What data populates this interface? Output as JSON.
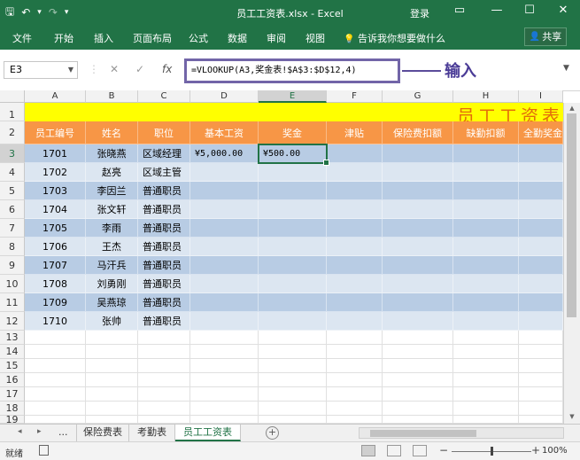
{
  "window": {
    "title": "员工工资表.xlsx - Excel",
    "login": "登录",
    "restore_icon": "▭",
    "minimize_icon": "—",
    "maximize_icon": "☐",
    "close_icon": "✕"
  },
  "qat": {
    "save_icon": "🖫",
    "undo_icon": "↶",
    "undo_dd": "▾",
    "redo_icon": "↷",
    "customize": "▾"
  },
  "ribbon": {
    "tabs": [
      "文件",
      "开始",
      "插入",
      "页面布局",
      "公式",
      "数据",
      "审阅",
      "视图"
    ],
    "tell_me": "告诉我你想要做什么",
    "tell_icon": "💡",
    "share": "共享",
    "share_icon": "👤"
  },
  "formula_bar": {
    "name_box": "E3",
    "cancel_icon": "✕",
    "enter_icon": "✓",
    "fx": "fx",
    "formula": "=VLOOKUP(A3,奖金表!$A$3:$D$12,4)",
    "annotation": "输入"
  },
  "columns": [
    "A",
    "B",
    "C",
    "D",
    "E",
    "F",
    "G",
    "H",
    "I"
  ],
  "rows": [
    "1",
    "2",
    "3",
    "4",
    "5",
    "6",
    "7",
    "8",
    "9",
    "10",
    "11",
    "12",
    "13",
    "14",
    "15",
    "16",
    "17",
    "18",
    "19"
  ],
  "sheet": {
    "title": "员工工资表",
    "headers": [
      "员工编号",
      "姓名",
      "职位",
      "基本工资",
      "奖金",
      "津贴",
      "保险费扣额",
      "缺勤扣额",
      "全勤奖金"
    ],
    "data": [
      [
        "1701",
        "张晓燕",
        "区域经理",
        "¥5,000.00",
        "¥500.00"
      ],
      [
        "1702",
        "赵亮",
        "区域主管",
        "",
        ""
      ],
      [
        "1703",
        "李因兰",
        "普通职员",
        "",
        ""
      ],
      [
        "1704",
        "张文轩",
        "普通职员",
        "",
        ""
      ],
      [
        "1705",
        "李雨",
        "普通职员",
        "",
        ""
      ],
      [
        "1706",
        "王杰",
        "普通职员",
        "",
        ""
      ],
      [
        "1707",
        "马汗兵",
        "普通职员",
        "",
        ""
      ],
      [
        "1708",
        "刘勇刚",
        "普通职员",
        "",
        ""
      ],
      [
        "1709",
        "吴燕琼",
        "普通职员",
        "",
        ""
      ],
      [
        "1710",
        "张帅",
        "普通职员",
        "",
        ""
      ]
    ]
  },
  "sheet_tabs": {
    "nav_prev": "◂",
    "nav_next": "▸",
    "more": "...",
    "tabs": [
      "保险费表",
      "考勤表",
      "员工工资表"
    ],
    "active": "员工工资表",
    "add": "+"
  },
  "status": {
    "ready": "就绪",
    "zoom": "100%",
    "zoom_minus": "−",
    "zoom_plus": "+"
  }
}
